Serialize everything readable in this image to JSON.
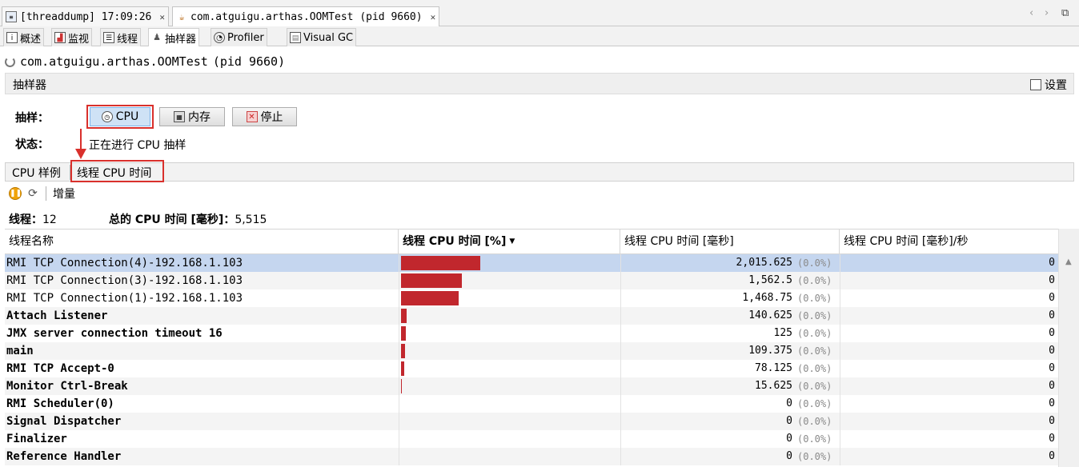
{
  "doc_tabs": [
    {
      "label": "[threaddump] 17:09:26",
      "icon": "threaddump-icon"
    },
    {
      "label": "com.atguigu.arthas.OOMTest (pid 9660)",
      "icon": "java-app-icon"
    }
  ],
  "window_controls": {
    "prev": "‹",
    "next": "›",
    "restore": "⧉"
  },
  "view_tabs": [
    {
      "label": "概述",
      "icon": "overview-icon"
    },
    {
      "label": "监视",
      "icon": "monitor-icon"
    },
    {
      "label": "线程",
      "icon": "threads-icon"
    },
    {
      "label": "抽样器",
      "icon": "sampler-icon"
    },
    {
      "label": "Profiler",
      "icon": "profiler-icon"
    },
    {
      "label": "Visual GC",
      "icon": "visual-gc-icon"
    }
  ],
  "app": {
    "name": "com.atguigu.arthas.OOMTest",
    "pid": "(pid 9660)"
  },
  "section": {
    "title": "抽样器",
    "settings_label": "设置"
  },
  "sample": {
    "label": "抽样：",
    "cpu_button": "CPU",
    "memory_button": "内存",
    "stop_button": "停止",
    "status_label": "状态：",
    "status_text": "正在进行 CPU 抽样"
  },
  "sub_tabs": [
    {
      "label": "CPU 样例"
    },
    {
      "label": "线程 CPU 时间"
    }
  ],
  "toolbar": {
    "delta_label": "增量"
  },
  "summary": {
    "threads_label": "线程：",
    "threads_value": "12",
    "total_label": "总的 CPU 时间 [毫秒]：",
    "total_value": "5,515"
  },
  "table": {
    "columns": [
      "线程名称",
      "线程 CPU 时间 [%]",
      "线程 CPU 时间 [毫秒]",
      "线程 CPU 时间 [毫秒]/秒"
    ],
    "rows": [
      {
        "name": "RMI TCP Connection(4)-192.168.1.103",
        "share": 0.3654,
        "ms": "2,015.625",
        "pct": "(0.0%)",
        "rate": "0"
      },
      {
        "name": "RMI TCP Connection(3)-192.168.1.103",
        "share": 0.2833,
        "ms": "1,562.5",
        "pct": "(0.0%)",
        "rate": "0"
      },
      {
        "name": "RMI TCP Connection(1)-192.168.1.103",
        "share": 0.2663,
        "ms": "1,468.75",
        "pct": "(0.0%)",
        "rate": "0"
      },
      {
        "name": "Attach Listener",
        "share": 0.0255,
        "ms": "140.625",
        "pct": "(0.0%)",
        "rate": "0"
      },
      {
        "name": "JMX server connection timeout 16",
        "share": 0.0227,
        "ms": "125",
        "pct": "(0.0%)",
        "rate": "0"
      },
      {
        "name": "main",
        "share": 0.0198,
        "ms": "109.375",
        "pct": "(0.0%)",
        "rate": "0"
      },
      {
        "name": "RMI TCP Accept-0",
        "share": 0.0142,
        "ms": "78.125",
        "pct": "(0.0%)",
        "rate": "0"
      },
      {
        "name": "Monitor Ctrl-Break",
        "share": 0.0028,
        "ms": "15.625",
        "pct": "(0.0%)",
        "rate": "0"
      },
      {
        "name": "RMI Scheduler(0)",
        "share": 0,
        "ms": "0",
        "pct": "(0.0%)",
        "rate": "0"
      },
      {
        "name": "Signal Dispatcher",
        "share": 0,
        "ms": "0",
        "pct": "(0.0%)",
        "rate": "0"
      },
      {
        "name": "Finalizer",
        "share": 0,
        "ms": "0",
        "pct": "(0.0%)",
        "rate": "0"
      },
      {
        "name": "Reference Handler",
        "share": 0,
        "ms": "0",
        "pct": "(0.0%)",
        "rate": "0"
      }
    ]
  },
  "colors": {
    "bar": "#c1272d",
    "highlight": "#d9302c",
    "selected_row": "#c5d6ef"
  }
}
